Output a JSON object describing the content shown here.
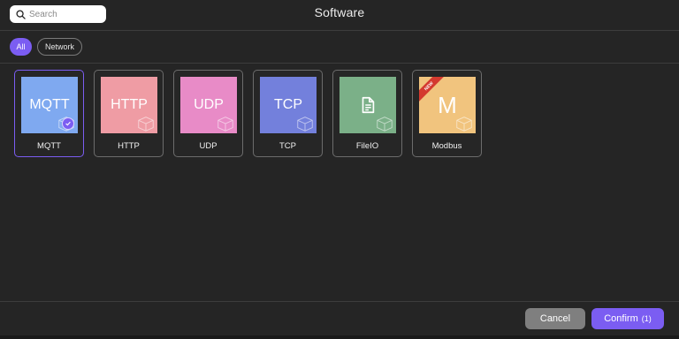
{
  "header": {
    "title": "Software",
    "search_placeholder": "Search"
  },
  "filters": [
    {
      "label": "All",
      "active": true
    },
    {
      "label": "Network",
      "active": false
    }
  ],
  "cards": [
    {
      "tile_text": "MQTT",
      "label": "MQTT",
      "color": "#7fa9f0",
      "selected": true
    },
    {
      "tile_text": "HTTP",
      "label": "HTTP",
      "color": "#ef9ca4"
    },
    {
      "tile_text": "UDP",
      "label": "UDP",
      "color": "#e88bc7"
    },
    {
      "tile_text": "TCP",
      "label": "TCP",
      "color": "#7380dc"
    },
    {
      "tile_icon": "file-document-icon",
      "label": "FileIO",
      "color": "#7bb088"
    },
    {
      "tile_text": "M",
      "label": "Modbus",
      "color": "#f1c47e",
      "badge": "NEW"
    }
  ],
  "footer": {
    "cancel_label": "Cancel",
    "confirm_label": "Confirm",
    "confirm_count": "(1)"
  },
  "colors": {
    "accent": "#7b5df2",
    "background": "#252525"
  }
}
